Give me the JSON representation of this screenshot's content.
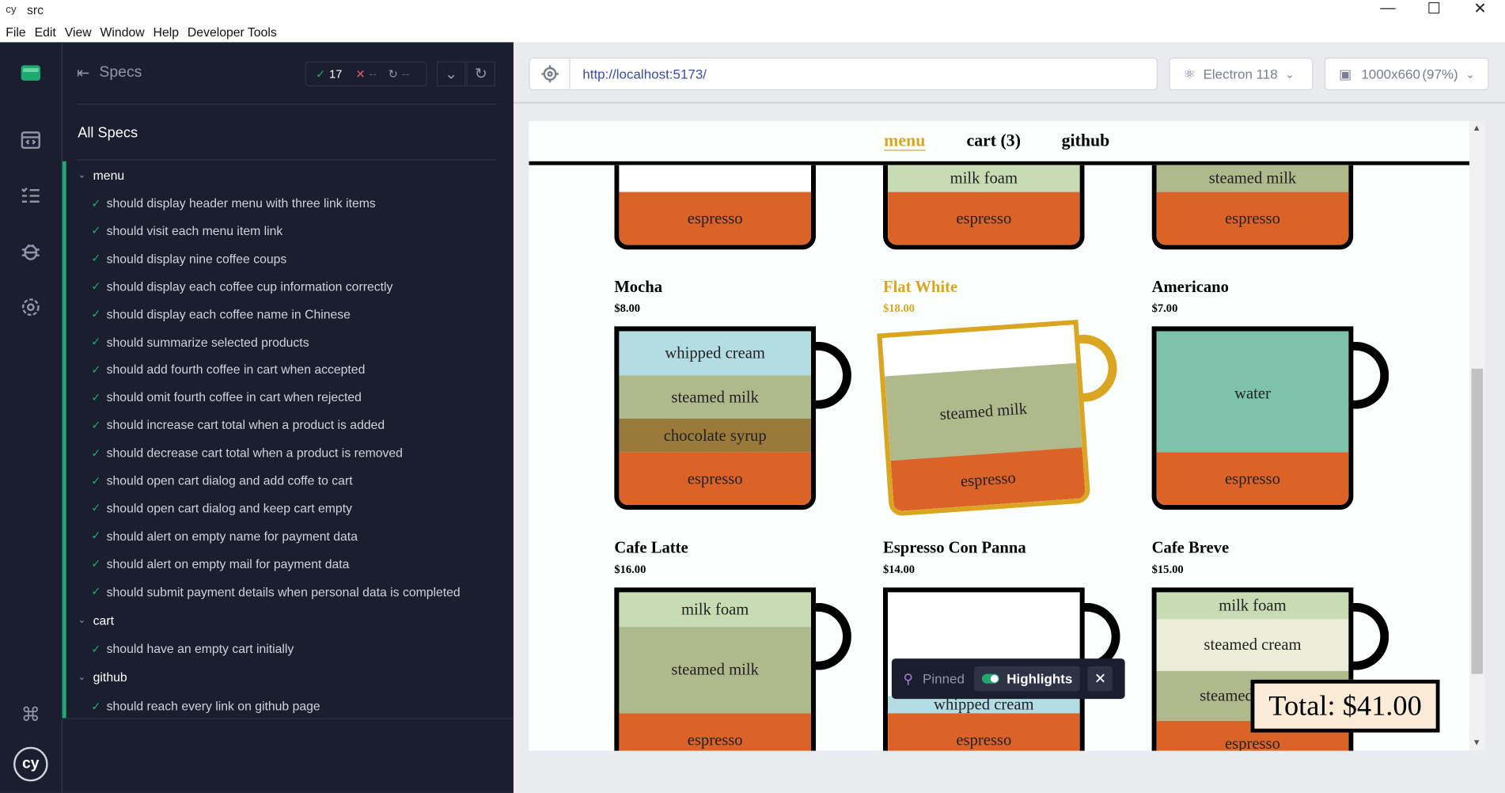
{
  "window": {
    "title": "src"
  },
  "menubar": [
    "File",
    "Edit",
    "View",
    "Window",
    "Help",
    "Developer Tools"
  ],
  "runner": {
    "specs_label": "Specs",
    "passed": "17",
    "failed": "--",
    "pending": "--",
    "all_specs": "All Specs",
    "suites": [
      {
        "name": "menu",
        "tests": [
          "should display header menu with three link items",
          "should visit each menu item link",
          "should display nine coffee coups",
          "should display each coffee cup information correctly",
          "should display each coffee name in Chinese",
          "should summarize selected products",
          "should add fourth coffee in cart when accepted",
          "should omit fourth coffee in cart when rejected",
          "should increase cart total when a product is added",
          "should decrease cart total when a product is removed",
          "should open cart dialog and add coffe to cart",
          "should open cart dialog and keep cart empty",
          "should alert on empty name for payment data",
          "should alert on empty mail for payment data",
          "should submit payment details when personal data is completed"
        ]
      },
      {
        "name": "cart",
        "tests": [
          "should have an empty cart initially"
        ]
      },
      {
        "name": "github",
        "tests": [
          "should reach every link on github page"
        ]
      }
    ]
  },
  "browser": {
    "url": "http://localhost:5173/",
    "engine": "Electron 118",
    "viewport": "1000x660",
    "zoom": "(97%)"
  },
  "app": {
    "nav": {
      "menu": "menu",
      "cart": "cart (3)",
      "github": "github"
    },
    "top_cups": [
      {
        "layers": [
          {
            "label": "espresso",
            "color": "#dc6328"
          }
        ]
      },
      {
        "layers": [
          {
            "label": "milk foam",
            "color": "#c8dcb4"
          },
          {
            "label": "espresso",
            "color": "#dc6328"
          }
        ]
      },
      {
        "layers": [
          {
            "label": "steamed milk",
            "color": "#b0b98c"
          },
          {
            "label": "espresso",
            "color": "#dc6328"
          }
        ]
      }
    ],
    "products": [
      {
        "name": "Mocha",
        "price": "$8.00",
        "layers": [
          {
            "label": "whipped cream",
            "color": "#b3dde2"
          },
          {
            "label": "steamed milk",
            "color": "#b0b98c"
          },
          {
            "label": "chocolate syrup",
            "color": "#9a7a3a"
          },
          {
            "label": "espresso",
            "color": "#dc6328"
          }
        ]
      },
      {
        "name": "Flat White",
        "price": "$18.00",
        "layers": [
          {
            "label": "",
            "color": "#ffffff"
          },
          {
            "label": "steamed milk",
            "color": "#b0b98c"
          },
          {
            "label": "espresso",
            "color": "#dc6328"
          }
        ]
      },
      {
        "name": "Americano",
        "price": "$7.00",
        "layers": [
          {
            "label": "water",
            "color": "#7fc2ab"
          },
          {
            "label": "espresso",
            "color": "#dc6328"
          }
        ]
      },
      {
        "name": "Cafe Latte",
        "price": "$16.00",
        "layers": [
          {
            "label": "milk foam",
            "color": "#c8dcb4"
          },
          {
            "label": "steamed milk",
            "color": "#b0b98c"
          },
          {
            "label": "espresso",
            "color": "#dc6328"
          }
        ]
      },
      {
        "name": "Espresso Con Panna",
        "price": "$14.00",
        "layers": [
          {
            "label": "",
            "color": "#ffffff"
          },
          {
            "label": "whipped cream",
            "color": "#b3dde2"
          },
          {
            "label": "espresso",
            "color": "#dc6328"
          }
        ]
      },
      {
        "name": "Cafe Breve",
        "price": "$15.00",
        "layers": [
          {
            "label": "milk foam",
            "color": "#c8dcb4"
          },
          {
            "label": "steamed cream",
            "color": "#ecedd9"
          },
          {
            "label": "steamed milk",
            "color": "#b0b98c"
          },
          {
            "label": "espresso",
            "color": "#dc6328"
          }
        ]
      }
    ],
    "total": "Total: $41.00",
    "highlight_color": "#daa520"
  },
  "pinned_bar": {
    "pinned": "Pinned",
    "highlights": "Highlights"
  }
}
